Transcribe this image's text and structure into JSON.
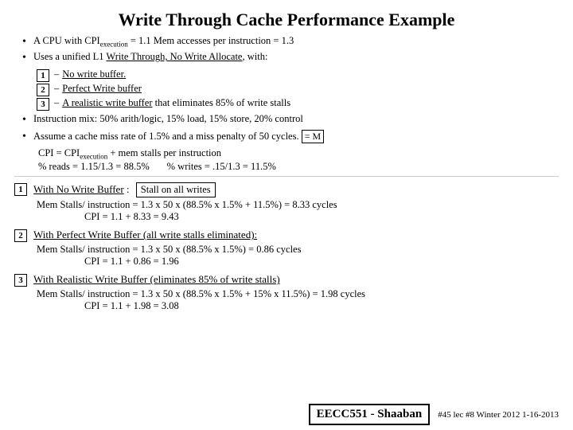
{
  "title": "Write Through Cache Performance Example",
  "bullets": [
    {
      "text_before": "A CPU with CPI",
      "subscript": "execution",
      "text_after": " = 1.1  Mem accesses per instruction =  1.3"
    },
    {
      "text": "Uses a unified L1 Write Through, No Write Allocate,  with:"
    }
  ],
  "numbered_items": [
    {
      "num": "1",
      "text": "No write buffer."
    },
    {
      "num": "2",
      "text": "Perfect Write buffer"
    },
    {
      "num": "3",
      "text_before": "A realistic write buffer",
      "text_after": " that eliminates 85% of write stalls"
    }
  ],
  "bullets2": [
    {
      "text": "Instruction mix:  50% arith/logic,  15% load, 15% store, 20% control"
    },
    {
      "text_before": "Assume a cache miss rate of 1.5% and a miss penalty of 50 cycles.",
      "box": "= M"
    }
  ],
  "formula1": "CPI =   CPI",
  "formula1_sub": "execution",
  "formula1_after": "  +  mem stalls per instruction",
  "formula2": "% reads =  1.15/1.3  =   88.5%        % writes =  .15/1.3 =  11.5%",
  "sections": [
    {
      "num": "1",
      "header_before": "With No Write Buffer :",
      "stall_label": "Stall on all writes",
      "lines": [
        "Mem Stalls/ instruction  =   1.3 x 50  x  (88.5%  x  1.5%  +  11.5%) = 8.33  cycles",
        "CPI =  1.1  + 8.33 =  9.43"
      ]
    },
    {
      "num": "2",
      "header": "With Perfect Write Buffer (all write stalls eliminated):",
      "lines": [
        "Mem Stalls/ instruction  =   1.3 x 50  x  (88.5%  x  1.5%) = 0.86  cycles",
        "CPI =  1.1  + 0.86 =   1.96"
      ]
    },
    {
      "num": "3",
      "header": "With Realistic Write Buffer (eliminates 85% of write stalls)",
      "lines": [
        "Mem Stalls/ instruction  =   1.3 x 50  x  (88.5%  x  1.5%  +  15% x 11.5%) = 1.98  cycles",
        "CPI =  1.1  + 1.98 =   3.08"
      ]
    }
  ],
  "footer": {
    "eecc": "EECC551 - Shaaban",
    "info": "#45  lec #8  Winter 2012  1-16-2013"
  }
}
